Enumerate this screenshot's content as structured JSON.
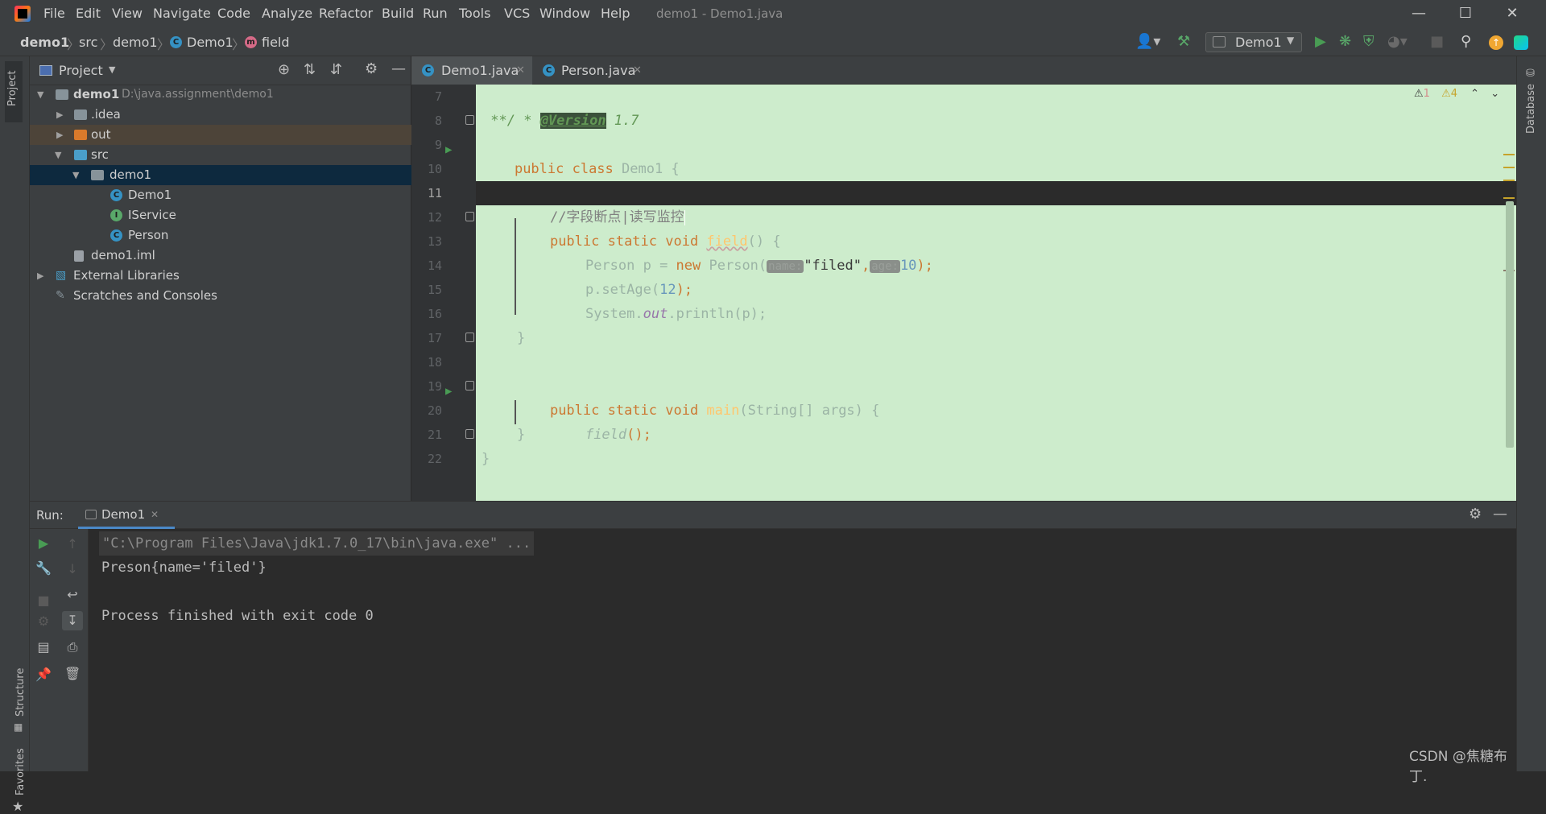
{
  "titlebar": {
    "menu": [
      "File",
      "Edit",
      "View",
      "Navigate",
      "Code",
      "Analyze",
      "Refactor",
      "Build",
      "Run",
      "Tools",
      "VCS",
      "Window",
      "Help"
    ],
    "window_title": "demo1 - Demo1.java"
  },
  "breadcrumb": {
    "items": [
      "demo1",
      "src",
      "demo1",
      "Demo1",
      "field"
    ],
    "run_config": "Demo1"
  },
  "project": {
    "header": "Project",
    "root_name": "demo1",
    "root_path": "D:\\java.assignment\\demo1",
    "tree": {
      "idea": ".idea",
      "out": "out",
      "src": "src",
      "pkg": "demo1",
      "demo1_class": "Demo1",
      "iservice": "IService",
      "person": "Person",
      "iml": "demo1.iml",
      "ext": "External Libraries",
      "scratch": "Scratches and Consoles"
    }
  },
  "left_stripe": {
    "project": "Project",
    "structure": "Structure",
    "favorites": "Favorites"
  },
  "right_stripe": {
    "database": "Database"
  },
  "tabs": [
    {
      "label": "Demo1.java",
      "active": true
    },
    {
      "label": "Person.java",
      "active": false
    }
  ],
  "inspections": {
    "errors": "1",
    "warnings": "4"
  },
  "editor": {
    "line_numbers": [
      "7",
      "8",
      "9",
      "10",
      "11",
      "12",
      "13",
      "14",
      "15",
      "16",
      "17",
      "18",
      "19",
      "20",
      "21",
      "22"
    ],
    "line7": {
      "star": " * ",
      "tag": "@Version",
      "rest": " 1.7"
    },
    "line8": " **/",
    "line9": {
      "kw": "public class ",
      "name": "Demo1 {"
    },
    "line11": "//字段断点|读写监控",
    "line12": {
      "kw": "public static void ",
      "fn": "field",
      "rest": "() {"
    },
    "line13": {
      "type": "Person p = ",
      "kw": "new ",
      "ctor": "Person(",
      "hint1": "name:",
      "str": "\"filed\"",
      "comma": ",",
      "hint2": "age:",
      "num": "10",
      "end": ");"
    },
    "line14": {
      "call": "p.setAge(",
      "num": "12",
      "end": ");"
    },
    "line15": {
      "pre": "System.",
      "out": "out",
      "post": ".println(p);"
    },
    "line17": "}",
    "line19": {
      "kw": "public static void ",
      "fn": "main",
      "rest": "(String[] args) {"
    },
    "line20": {
      "fn": "field",
      "rest": "();"
    },
    "line21": "}",
    "line22": "}"
  },
  "run": {
    "label": "Run:",
    "tab": "Demo1",
    "console": [
      "\"C:\\Program Files\\Java\\jdk1.7.0_17\\bin\\java.exe\" ...",
      "Preson{name='filed'}",
      "",
      "Process finished with exit code 0"
    ]
  },
  "watermark": "CSDN @焦糖布丁.",
  "colors": {
    "editor_bg": "#cdeccc",
    "panel_bg": "#3c3f41",
    "selection": "#0d293e",
    "keyword": "#cc7832",
    "run_green": "#499c54"
  }
}
